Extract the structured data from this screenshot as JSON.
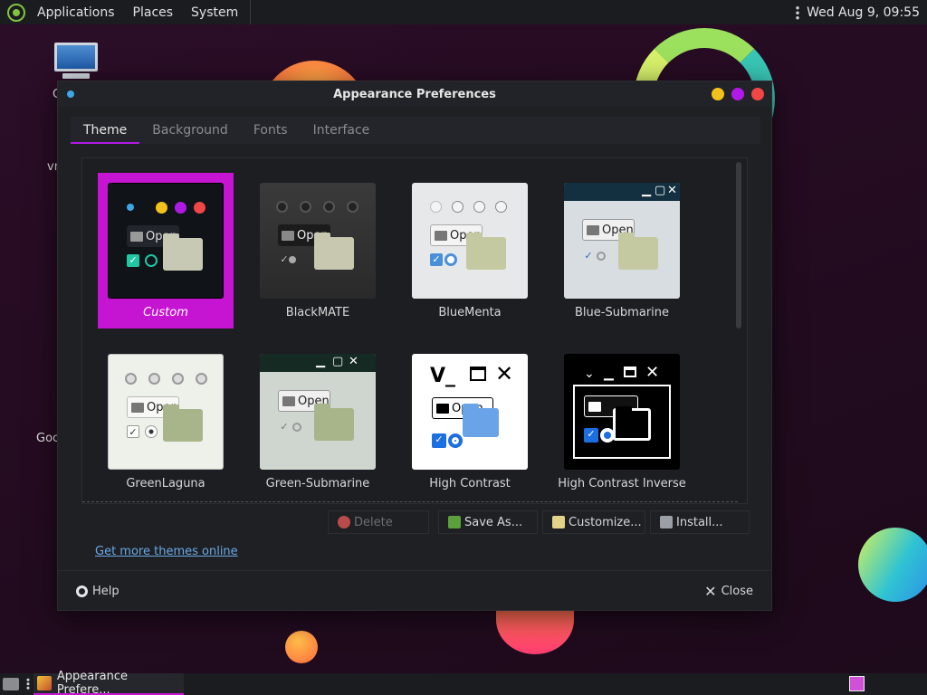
{
  "top_panel": {
    "menus": [
      "Applications",
      "Places",
      "System"
    ],
    "clock": "Wed Aug  9, 09:55"
  },
  "desktop": {
    "labels": [
      "C",
      "vn",
      "Goc"
    ]
  },
  "window": {
    "title": "Appearance Preferences",
    "tabs": [
      {
        "label": "Theme",
        "active": true
      },
      {
        "label": "Background",
        "active": false
      },
      {
        "label": "Fonts",
        "active": false
      },
      {
        "label": "Interface",
        "active": false
      }
    ],
    "thumb_open_label": "Open",
    "themes": [
      {
        "name": "Custom",
        "selected": true
      },
      {
        "name": "BlackMATE",
        "selected": false
      },
      {
        "name": "BlueMenta",
        "selected": false
      },
      {
        "name": "Blue-Submarine",
        "selected": false
      },
      {
        "name": "GreenLaguna",
        "selected": false
      },
      {
        "name": "Green-Submarine",
        "selected": false
      },
      {
        "name": "High Contrast",
        "selected": false
      },
      {
        "name": "High Contrast Inverse",
        "selected": false
      }
    ],
    "actions": {
      "delete": "Delete",
      "save_as": "Save As...",
      "customize": "Customize...",
      "install": "Install..."
    },
    "link": "Get more themes online",
    "help": "Help",
    "close": "Close"
  },
  "bottom_panel": {
    "task": "Appearance Prefere..."
  },
  "colors": {
    "accent": "#c514d2",
    "window_bg": "#1f2024",
    "link": "#6aa9e6"
  }
}
